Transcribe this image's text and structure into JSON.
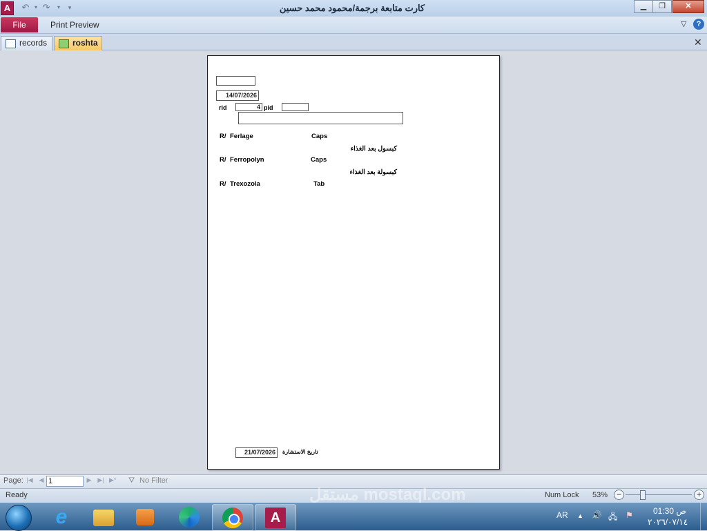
{
  "window": {
    "title": "كارت متابعة برجمة/محمود محمد حسين",
    "app_icon_letter": "A",
    "controls": [
      "minimize",
      "maximize",
      "close"
    ]
  },
  "ribbon": {
    "file_tab": "File",
    "print_preview_tab": "Print Preview"
  },
  "doc_tabs": [
    {
      "label": "records",
      "icon": "form-icon",
      "active": false
    },
    {
      "label": "roshta",
      "icon": "report-icon",
      "active": true
    }
  ],
  "report": {
    "top_field": "",
    "date": "14/07/2026",
    "rid_label": "rid",
    "rid_value": "4",
    "pid_label": "pid",
    "pid_value": "",
    "name_field": "",
    "drugs": [
      {
        "prefix": "R/",
        "name": "Ferlage",
        "form": "Caps",
        "instruction": "كبسول بعد الغذاء"
      },
      {
        "prefix": "R/",
        "name": "Ferropolyn",
        "form": "Caps",
        "instruction": "كبسولة بعد الغذاء"
      },
      {
        "prefix": "R/",
        "name": "Trexozola",
        "form": "Tab",
        "instruction": ""
      }
    ],
    "consult_date": "21/07/2026",
    "consult_label": "تاريخ الاستشارة"
  },
  "navigation": {
    "page_label": "Page:",
    "page_value": "1",
    "filter_label": "No Filter"
  },
  "status": {
    "ready": "Ready",
    "num_lock": "Num Lock",
    "zoom": "53%",
    "zoom_fraction": 0.53
  },
  "taskbar": {
    "apps": [
      "internet-explorer",
      "file-explorer",
      "media-player",
      "edge",
      "chrome",
      "access"
    ],
    "language": "AR",
    "time": "01:30 ص",
    "date": "٢٠٢٦/٠٧/١٤"
  }
}
